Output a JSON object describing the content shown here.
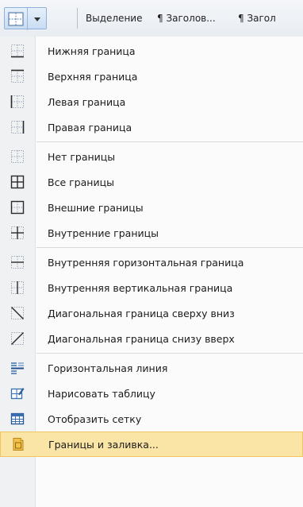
{
  "toolbar": {
    "borders_button_icon": "borders-grid-icon",
    "dropdown_icon": "chevron-down-icon",
    "style_chips": [
      "Выделение",
      "¶ Заголов...",
      "¶ Загол"
    ]
  },
  "menu": {
    "items": [
      {
        "label": "Нижняя граница",
        "icon": "border-bottom-icon"
      },
      {
        "label": "Верхняя граница",
        "icon": "border-top-icon"
      },
      {
        "label": "Левая граница",
        "icon": "border-left-icon"
      },
      {
        "label": "Правая граница",
        "icon": "border-right-icon"
      },
      {
        "label": "Нет границы",
        "icon": "border-none-icon"
      },
      {
        "label": "Все границы",
        "icon": "border-all-icon"
      },
      {
        "label": "Внешние границы",
        "icon": "border-outside-icon"
      },
      {
        "label": "Внутренние границы",
        "icon": "border-inside-icon"
      },
      {
        "label": "Внутренняя горизонтальная граница",
        "icon": "border-inside-horizontal-icon"
      },
      {
        "label": "Внутренняя вертикальная граница",
        "icon": "border-inside-vertical-icon"
      },
      {
        "label": "Диагональная граница сверху вниз",
        "icon": "diagonal-down-icon"
      },
      {
        "label": "Диагональная граница снизу вверх",
        "icon": "diagonal-up-icon"
      },
      {
        "label": "Горизонтальная линия",
        "icon": "horizontal-line-icon"
      },
      {
        "label": "Нарисовать таблицу",
        "icon": "draw-table-icon"
      },
      {
        "label": "Отобразить сетку",
        "icon": "view-gridlines-icon"
      },
      {
        "label": "Границы и заливка...",
        "icon": "borders-shading-icon"
      }
    ],
    "highlighted_item": "Границы и заливка..."
  },
  "colors": {
    "highlight_bg": "#fbe5a6",
    "highlight_border": "#f0c75e",
    "icon_blue": "#3a6fb0"
  }
}
